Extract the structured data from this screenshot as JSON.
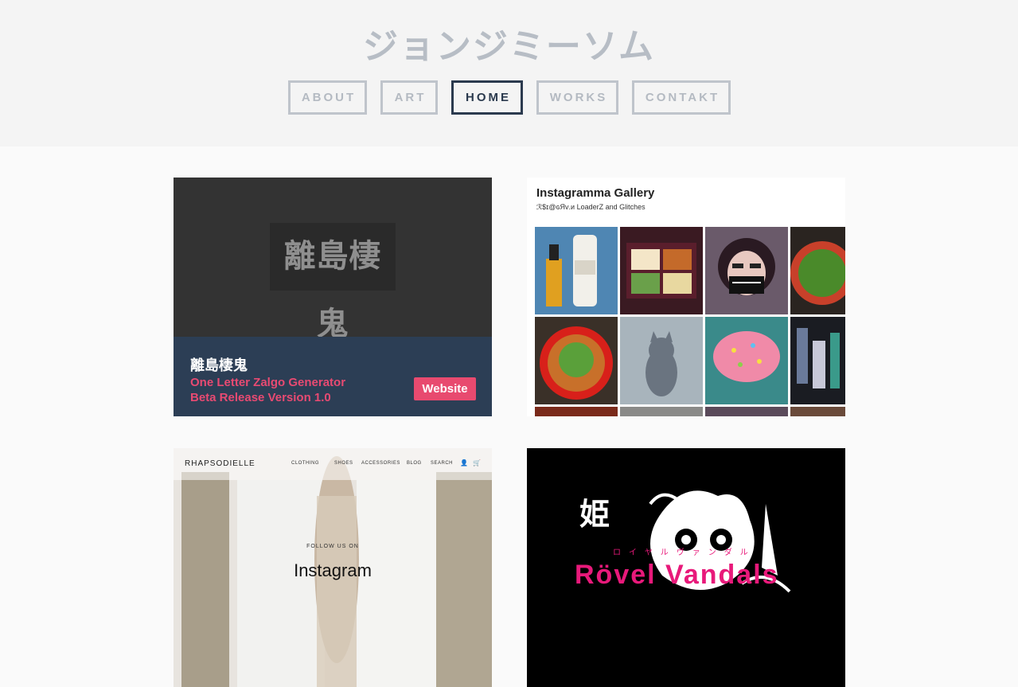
{
  "site": {
    "title": "ジョンジミーソム"
  },
  "nav": {
    "items": [
      "ABOUT",
      "ART",
      "HOME",
      "WORKS",
      "CONTAKT"
    ],
    "active": "HOME"
  },
  "projects": [
    {
      "image_text": "離島棲鬼",
      "title": "離島棲鬼",
      "line1": "One Letter Zalgo Generator",
      "line2": "Beta Release Version 1.0",
      "button": "Website"
    },
    {
      "title": "Instagramma Gallery",
      "subtitle": "ℛ$ɪ@ɢЯᴠ.ᴎ LoaderZ and Glitches"
    },
    {
      "brand": "RHAPSODIELLE",
      "menu": [
        "CLOTHING",
        "SHOES",
        "ACCESSORIES",
        "BLOG",
        "SEARCH"
      ],
      "follow": "FOLLOW US ON",
      "instagram": "Instagram"
    },
    {
      "kanji": "姫",
      "katakana": "ロイヤルヴァンダル",
      "title": "Rövel Vandals"
    }
  ],
  "colors": {
    "nav_border": "#bfc4cb",
    "nav_active": "#2b3a4e",
    "caption_bg": "#2c3e55",
    "accent_pink": "#e84a6f"
  }
}
